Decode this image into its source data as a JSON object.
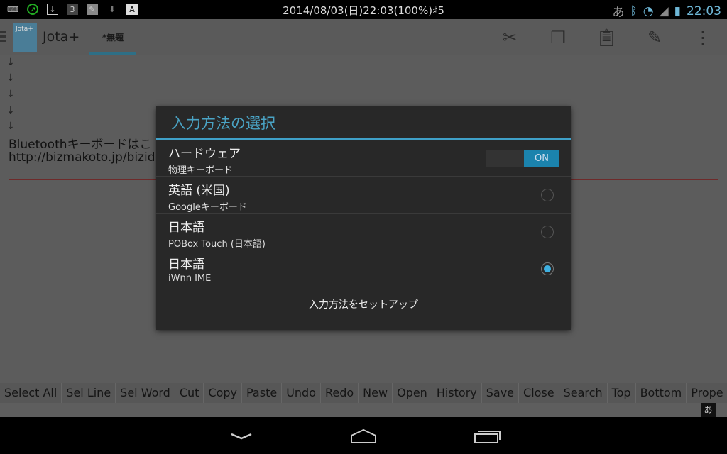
{
  "status_bar": {
    "center_text": "2014/08/03(日)22:03(100%)♯5",
    "time": "22:03",
    "ime_indicator": "あ",
    "left_icons": [
      "keyboard-icon",
      "gps-icon",
      "download-icon",
      "notification-3-icon",
      "app-icon",
      "download-arrow-icon",
      "font-icon"
    ],
    "right_icons": [
      "bluetooth-icon",
      "wifi-icon",
      "signal-icon",
      "battery-icon"
    ]
  },
  "action_bar": {
    "app_name": "Jota+",
    "logo_text": "Jota+",
    "tab": "*無題",
    "actions": [
      "cut-icon",
      "copy-icon",
      "paste-icon",
      "edit-icon",
      "overflow-icon"
    ]
  },
  "editor": {
    "arrows": [
      "↓",
      "↓",
      "↓",
      "↓",
      "↓"
    ],
    "lines": [
      "Bluetoothキーボードはこ",
      "http://bizmakoto.jp/bizid"
    ]
  },
  "function_bar": [
    "Select All",
    "Sel Line",
    "Sel Word",
    "Cut",
    "Copy",
    "Paste",
    "Undo",
    "Redo",
    "New",
    "Open",
    "History",
    "Save",
    "Close",
    "Search",
    "Top",
    "Bottom",
    "Prope"
  ],
  "keyboard_indicator": "あ",
  "dialog": {
    "title": "入力方法の選択",
    "hardware": {
      "title": "ハードウェア",
      "subtitle": "物理キーボード",
      "toggle": "ON"
    },
    "options": [
      {
        "title": "英語 (米国)",
        "subtitle": "Googleキーボード",
        "selected": false
      },
      {
        "title": "日本語",
        "subtitle": "POBox Touch (日本語)",
        "selected": false
      },
      {
        "title": "日本語",
        "subtitle": "iWnn IME",
        "selected": true
      }
    ],
    "footer": "入力方法をセットアップ"
  },
  "colors": {
    "accent": "#3fa0c8",
    "toggle_on": "#1b83ad",
    "radio_selected": "#3fb0e0"
  }
}
